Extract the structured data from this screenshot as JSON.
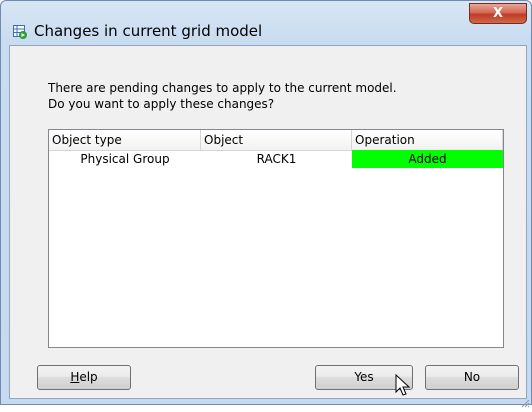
{
  "window": {
    "title": "Changes in current grid model",
    "close_label": "X",
    "icon": "grid-model-app-icon"
  },
  "message": {
    "line1": "There are pending changes to apply to the current model.",
    "line2": "Do you want to apply these changes?"
  },
  "table": {
    "columns": [
      "Object type",
      "Object",
      "Operation"
    ],
    "rows": [
      {
        "object_type": "Physical Group",
        "object": "RACK1",
        "operation": "Added"
      }
    ],
    "operation_colors": {
      "Added": "#00ff00"
    }
  },
  "buttons": {
    "help": {
      "mnemonic": "H",
      "rest": "elp"
    },
    "yes": "Yes",
    "no": "No"
  },
  "colors": {
    "frame": "#c9dcf0",
    "close_button": "#c03a24",
    "client_background": "#f0f0f0"
  }
}
